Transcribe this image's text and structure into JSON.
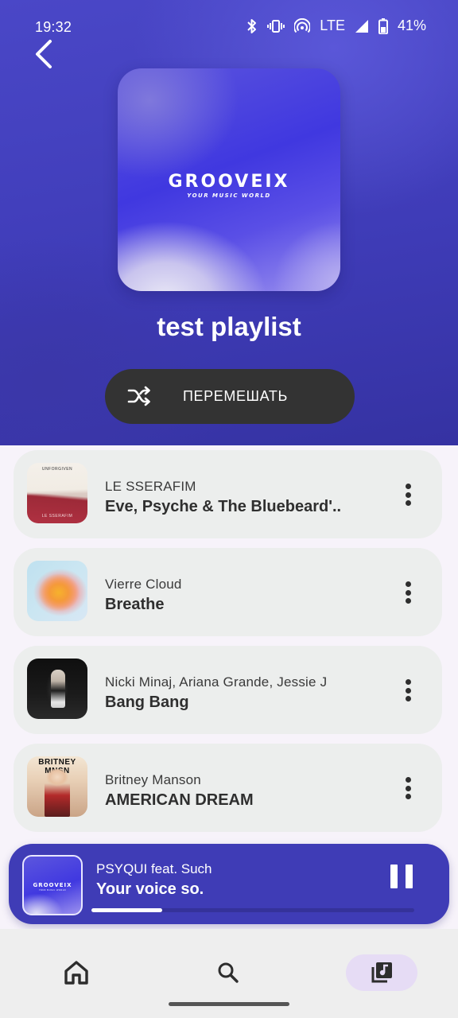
{
  "status_bar": {
    "time": "19:32",
    "network": "LTE",
    "battery": "41%"
  },
  "header": {
    "cover_logo": "GROOVEIX",
    "cover_tagline": "YOUR MUSIC WORLD",
    "playlist_title": "test playlist",
    "shuffle_label": "ПЕРЕМЕШАТЬ"
  },
  "tracks": [
    {
      "artist": "LE SSERAFIM",
      "title": "Eve, Psyche & The Bluebeard'..",
      "art_top": "UNFORGIVEN",
      "art_bottom": "LE SSERAFIM"
    },
    {
      "artist": "Vierre Cloud",
      "title": "Breathe"
    },
    {
      "artist": "Nicki Minaj, Ariana Grande, Jessie J",
      "title": "Bang Bang"
    },
    {
      "artist": "Britney Manson",
      "title": "AMERICAN DREAM",
      "art_top": "BRITNEY MNSN"
    }
  ],
  "mini_player": {
    "artist": "PSYQUI feat. Such",
    "title": "Your voice so.",
    "art_logo": "GROOVEIX",
    "art_tagline": "YOUR MUSIC WORLD",
    "progress": 0.22,
    "state": "playing"
  },
  "bottom_nav": {
    "items": [
      "home-icon",
      "search-icon",
      "library-music-icon"
    ],
    "active": "library-music-icon"
  },
  "colors": {
    "header": "#4240bf",
    "accent": "#3f3cb6",
    "shuffle_button": "#333333",
    "track_card": "#eceeed",
    "nav_active": "#e6dcf5"
  }
}
